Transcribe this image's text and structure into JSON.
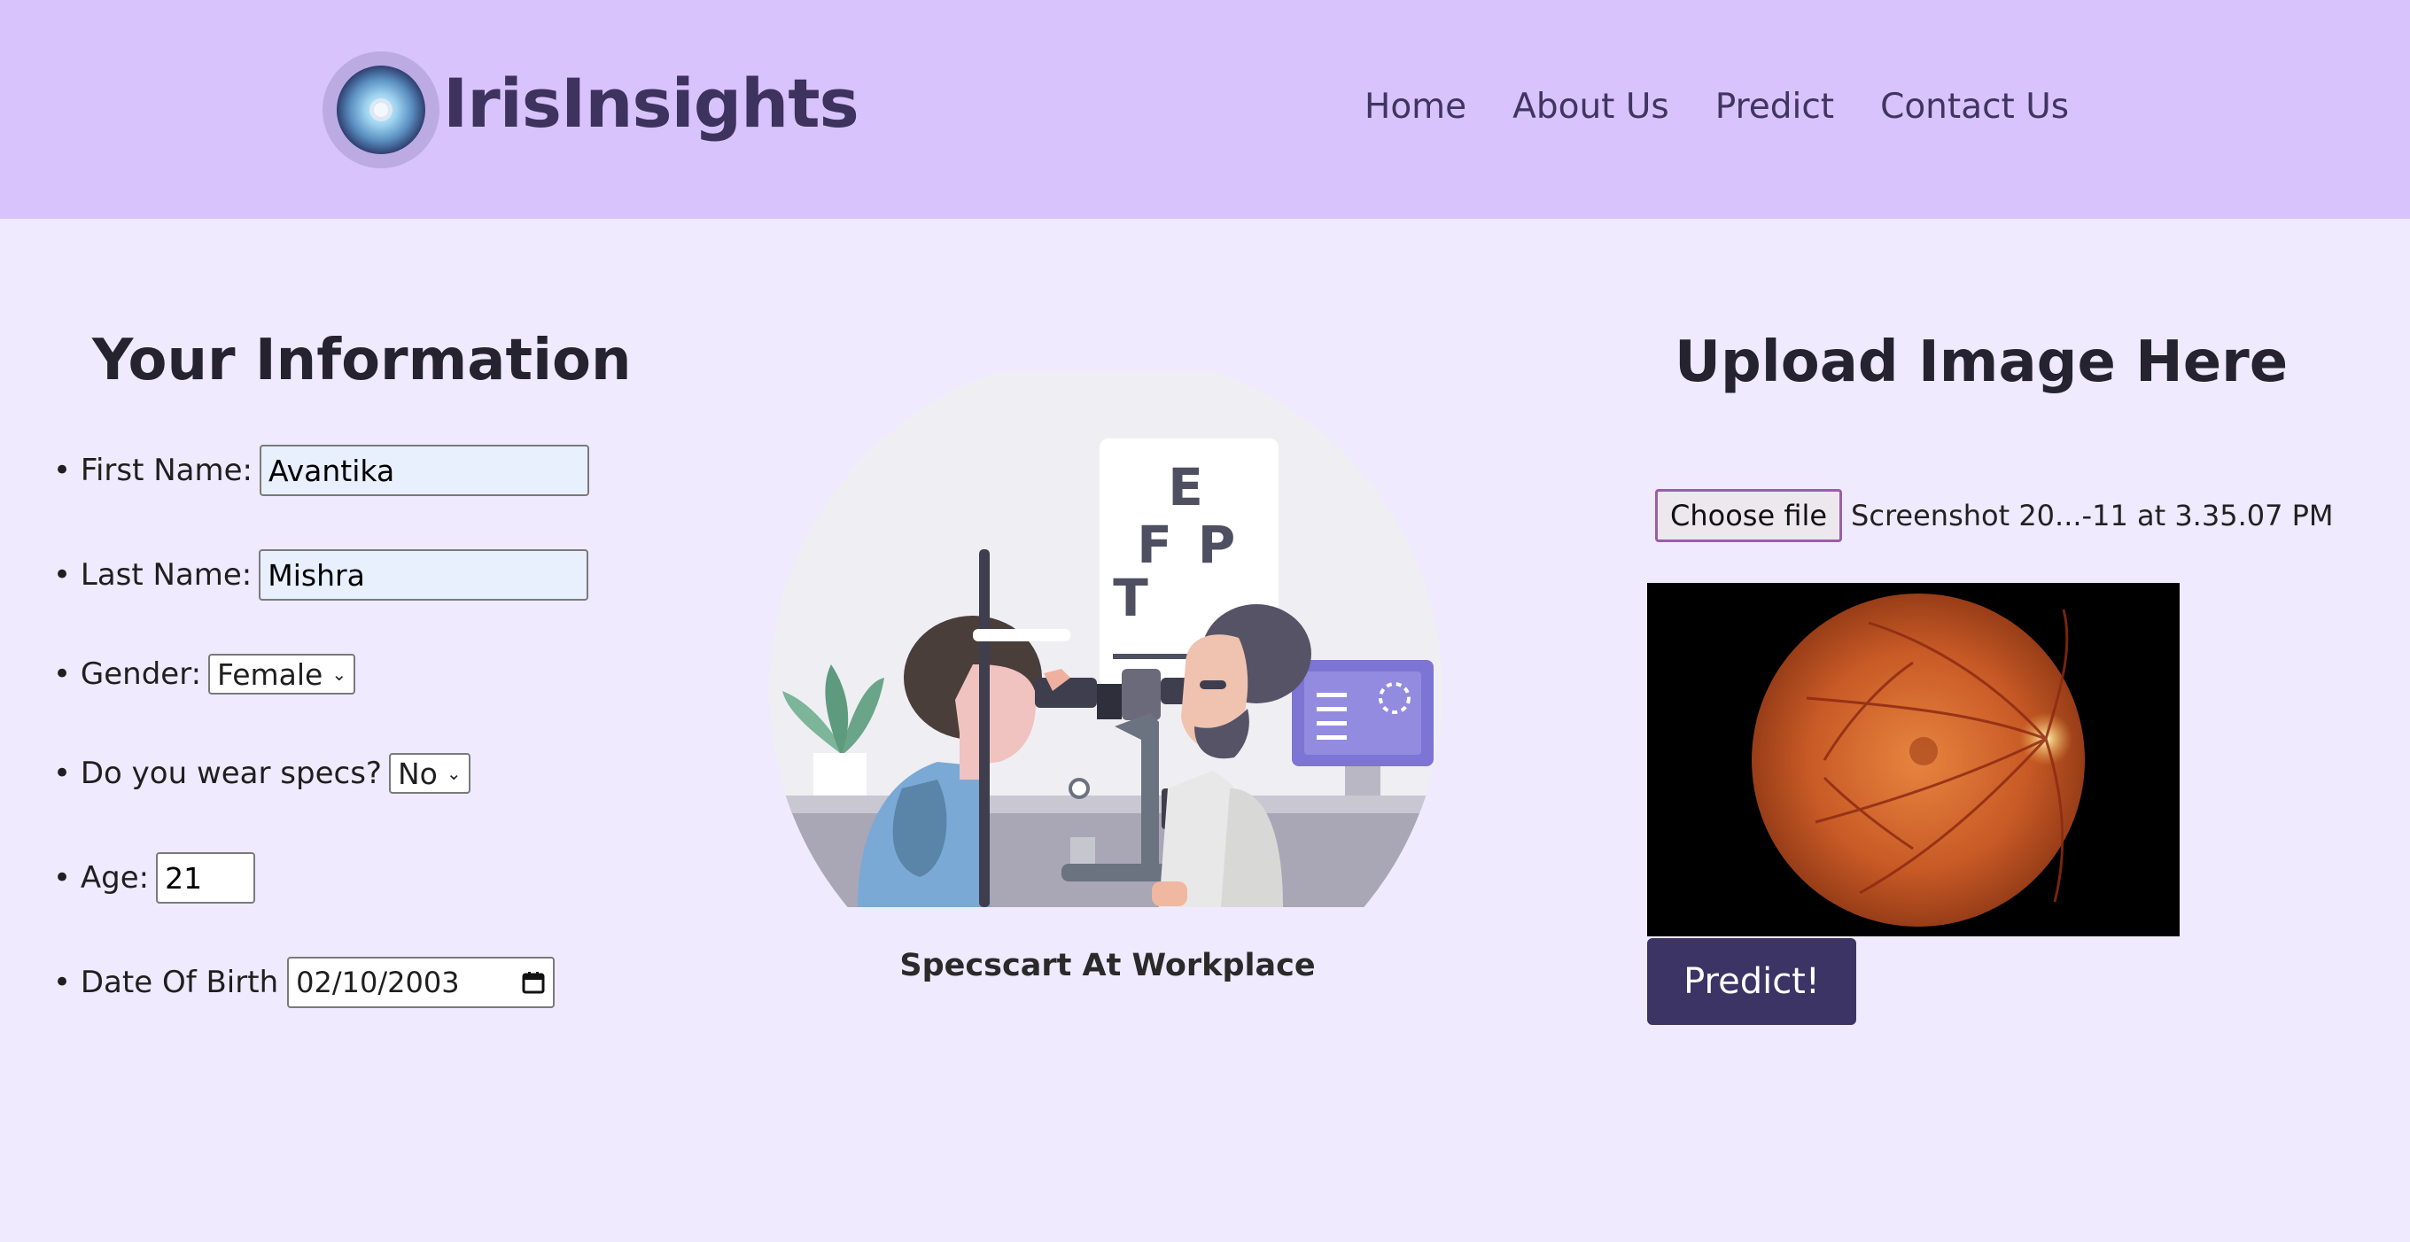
{
  "header": {
    "brand": "IrisInsights",
    "nav": [
      "Home",
      "About Us",
      "Predict",
      "Contact Us"
    ],
    "bg_color": "#d8c3fc",
    "logo_icon": "iris-eye-icon"
  },
  "form": {
    "title": "Your Information",
    "first_name": {
      "label": "First Name:",
      "value": "Avantika"
    },
    "last_name": {
      "label": "Last Name:",
      "value": "Mishra"
    },
    "gender": {
      "label": "Gender:",
      "value": "Female"
    },
    "specs": {
      "label": "Do you wear specs?",
      "value": "No"
    },
    "age": {
      "label": "Age:",
      "value": "21"
    },
    "dob": {
      "label": "Date Of Birth",
      "value": "02/10/2003"
    }
  },
  "illustration": {
    "caption": "Specscart At Workplace",
    "chart_letters": [
      "E",
      "F",
      "P",
      "T"
    ]
  },
  "upload": {
    "title": "Upload Image Here",
    "choose_label": "Choose file",
    "file_name": "Screenshot 20...-11 at 3.35.07 PM",
    "predict_label": "Predict!",
    "accent": "#3b3464"
  }
}
